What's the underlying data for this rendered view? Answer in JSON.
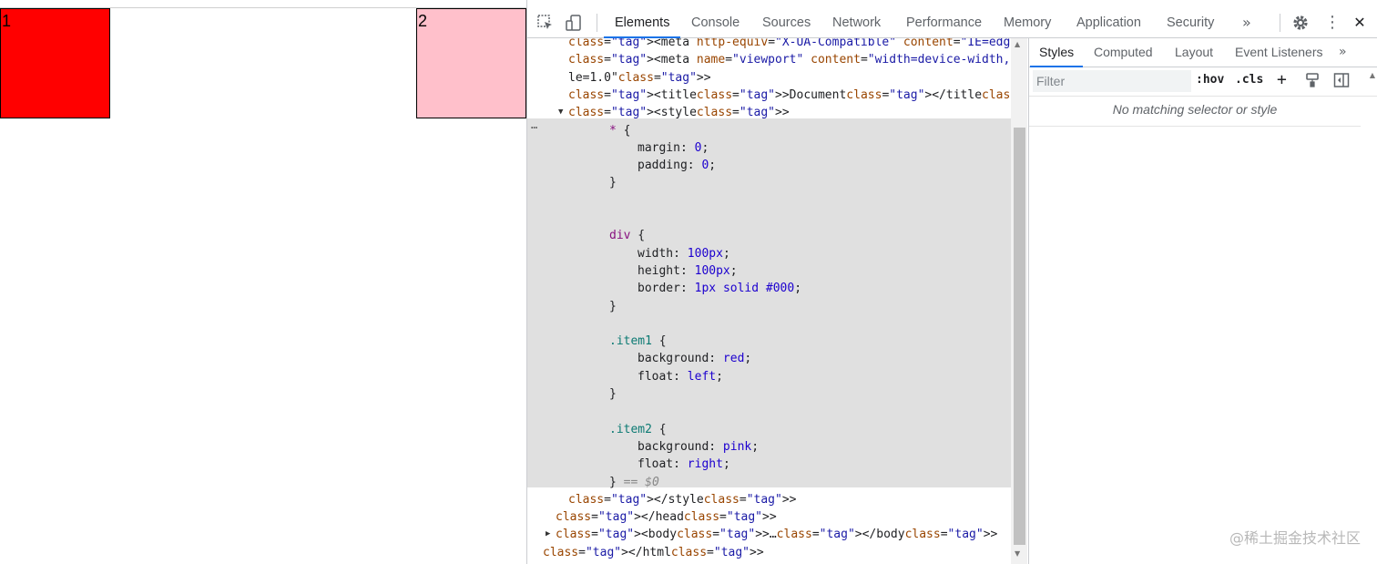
{
  "viewport": {
    "box1": {
      "label": "1",
      "color": "#ff0000"
    },
    "box2": {
      "label": "2",
      "color": "#ffc0cb"
    }
  },
  "devtools": {
    "tabs": [
      "Elements",
      "Console",
      "Sources",
      "Network",
      "Performance",
      "Memory",
      "Application",
      "Security"
    ],
    "active_tab": "Elements",
    "more_tabs": "»",
    "icons": [
      "inspect-element-icon",
      "device-toolbar-icon",
      "settings-gear-icon",
      "more-vertical-icon",
      "close-icon"
    ],
    "close_glyph": "✕",
    "menu_glyph": "⋮"
  },
  "tree": {
    "lines": [
      {
        "indent": 0,
        "text": "<meta http-equiv=\"X-UA-Compatible\" content=\"IE=edge\">"
      },
      {
        "indent": 0,
        "text": "<meta name=\"viewport\" content=\"width=device-width, initial-sca"
      },
      {
        "indent": 0,
        "text": "le=1.0\">"
      },
      {
        "indent": 0,
        "text": "<title>Document</title>"
      },
      {
        "indent": 0,
        "text": "<style>"
      },
      {
        "indent": 1,
        "text": "* {"
      },
      {
        "indent": 2,
        "text": "margin: 0;"
      },
      {
        "indent": 2,
        "text": "padding: 0;"
      },
      {
        "indent": 1,
        "text": "}"
      },
      {
        "indent": 0,
        "text": ""
      },
      {
        "indent": 0,
        "text": ""
      },
      {
        "indent": 1,
        "text": "div {"
      },
      {
        "indent": 2,
        "text": "width: 100px;"
      },
      {
        "indent": 2,
        "text": "height: 100px;"
      },
      {
        "indent": 2,
        "text": "border: 1px solid #000;"
      },
      {
        "indent": 1,
        "text": "}"
      },
      {
        "indent": 0,
        "text": ""
      },
      {
        "indent": 1,
        "text": ".item1 {"
      },
      {
        "indent": 2,
        "text": "background: red;"
      },
      {
        "indent": 2,
        "text": "float: left;"
      },
      {
        "indent": 1,
        "text": "}"
      },
      {
        "indent": 0,
        "text": ""
      },
      {
        "indent": 1,
        "text": ".item2 {"
      },
      {
        "indent": 2,
        "text": "background: pink;"
      },
      {
        "indent": 2,
        "text": "float: right;"
      },
      {
        "indent": 1,
        "text": "} == $0"
      },
      {
        "indent": 0,
        "text": "</style>"
      },
      {
        "indent": 0,
        "text": "</head>"
      },
      {
        "indent": 0,
        "text": "<body>…</body>"
      },
      {
        "indent": 0,
        "text": "</html>"
      }
    ],
    "dots": "…"
  },
  "styles": {
    "subtabs": [
      "Styles",
      "Computed",
      "Layout",
      "Event Listeners"
    ],
    "more": "»",
    "filter_placeholder": "Filter",
    "hov": ":hov",
    "cls": ".cls",
    "plus": "+",
    "no_match": "No matching selector or style"
  },
  "watermark": "@稀土掘金技术社区"
}
